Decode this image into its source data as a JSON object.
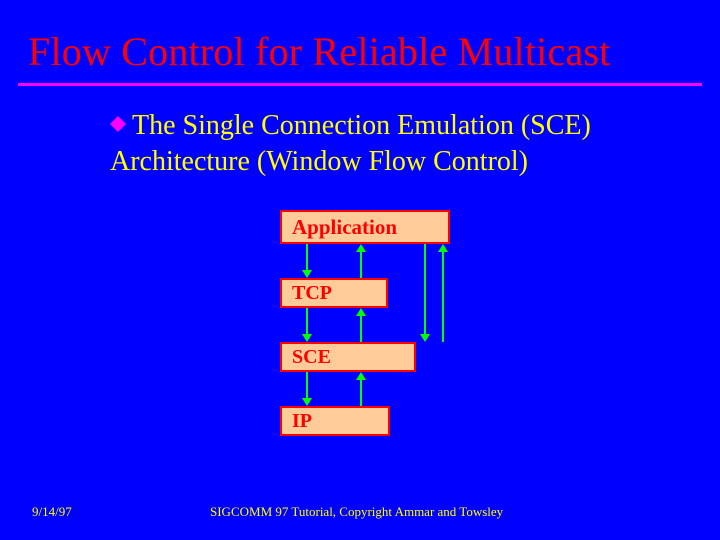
{
  "title": "Flow Control for Reliable Multicast",
  "bullet": {
    "text": "The Single Connection Emulation (SCE) Architecture (Window Flow Control)"
  },
  "layers": {
    "application": "Application",
    "tcp": "TCP",
    "sce": "SCE",
    "ip": "IP"
  },
  "footer": {
    "date": "9/14/97",
    "copyright": "SIGCOMM 97 Tutorial, Copyright Ammar and Towsley"
  },
  "colors": {
    "background": "#0000ff",
    "title": "#ff0000",
    "rule": "#ff00ff",
    "body_text": "#ffff00",
    "box_fill": "#ffcc99",
    "box_border": "#ff0000",
    "arrow": "#00ff00"
  }
}
